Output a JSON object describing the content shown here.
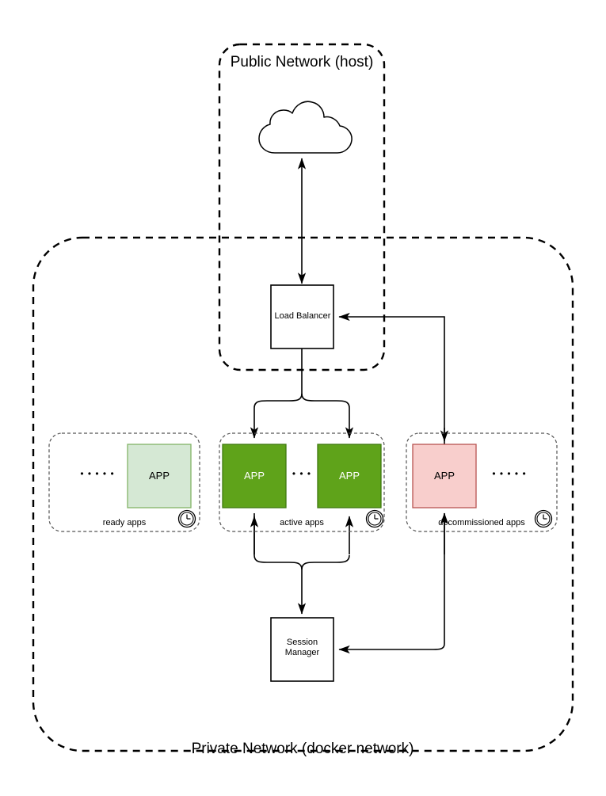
{
  "diagram": {
    "title_public": "Public Network (host)",
    "title_private": "Private Network (docker network)",
    "cloud_icon": "cloud-icon",
    "nodes": {
      "load_balancer": "Load Balancer",
      "session_manager_line1": "Session",
      "session_manager_line2": "Manager"
    },
    "groups": [
      {
        "id": "ready",
        "label": "ready apps",
        "app_label": "APP",
        "fill": "#d5e8d4",
        "stroke": "#82b366",
        "text_color": "#000000",
        "clock_icon": "clock-icon",
        "ellipsis": "• • • • •"
      },
      {
        "id": "active",
        "label": "active apps",
        "app_label": "APP",
        "app_label_2": "APP",
        "fill": "#5fa31a",
        "stroke": "#3f7a10",
        "text_color": "#ffffff",
        "clock_icon": "clock-icon",
        "ellipsis": "• • •"
      },
      {
        "id": "decommissioned",
        "label": "decommissioned apps",
        "app_label": "APP",
        "fill": "#f8cecc",
        "stroke": "#b85450",
        "text_color": "#000000",
        "clock_icon": "clock-icon",
        "ellipsis": "• • • • •"
      }
    ],
    "colors": {
      "line": "#000000",
      "boundary": "#000000",
      "group_boundary": "#666666",
      "background": "#ffffff"
    }
  }
}
